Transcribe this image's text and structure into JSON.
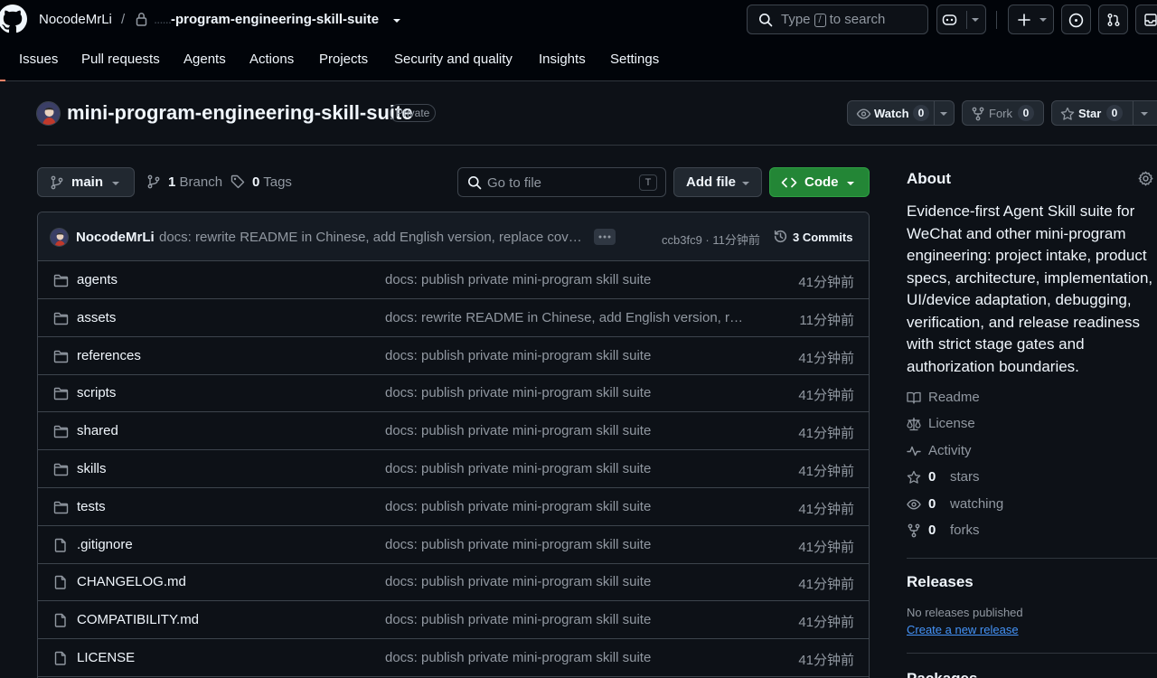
{
  "header": {
    "owner": "NocodeMrLi",
    "separator": "/",
    "repo_redacted": "......",
    "repo_crumb": "-program-engineering-skill-suite",
    "search_prefix": "Type",
    "search_key": "/",
    "search_suffix": "to search"
  },
  "nav": {
    "tabs": [
      {
        "label": "Issues"
      },
      {
        "label": "Pull requests"
      },
      {
        "label": "Agents"
      },
      {
        "label": "Actions"
      },
      {
        "label": "Projects"
      },
      {
        "label": "Security and quality"
      },
      {
        "label": "Insights"
      },
      {
        "label": "Settings"
      }
    ]
  },
  "repo": {
    "name": "mini-program-engineering-skill-suite",
    "visibility": "Private",
    "watch_label": "Watch",
    "watch_count": "0",
    "fork_label": "Fork",
    "fork_count": "0",
    "star_label": "Star",
    "star_count": "0"
  },
  "controls": {
    "branch": "main",
    "branch_count": "1",
    "branch_label": "Branch",
    "tag_count": "0",
    "tag_label": "Tags",
    "goto_placeholder": "Go to file",
    "goto_key": "T",
    "add_file_label": "Add file",
    "code_label": "Code"
  },
  "latest_commit": {
    "author": "NocodeMrLi",
    "message": "docs: rewrite README in Chinese, add English version, replace cover image",
    "sha_time": "ccb3fc9 · 11分钟前",
    "commits_label": "3 Commits"
  },
  "files": [
    {
      "type": "dir",
      "name": "agents",
      "message": "docs: publish private mini-program skill suite",
      "time": "41分钟前"
    },
    {
      "type": "dir",
      "name": "assets",
      "message": "docs: rewrite README in Chinese, add English version, replace cover image",
      "time": "11分钟前"
    },
    {
      "type": "dir",
      "name": "references",
      "message": "docs: publish private mini-program skill suite",
      "time": "41分钟前"
    },
    {
      "type": "dir",
      "name": "scripts",
      "message": "docs: publish private mini-program skill suite",
      "time": "41分钟前"
    },
    {
      "type": "dir",
      "name": "shared",
      "message": "docs: publish private mini-program skill suite",
      "time": "41分钟前"
    },
    {
      "type": "dir",
      "name": "skills",
      "message": "docs: publish private mini-program skill suite",
      "time": "41分钟前"
    },
    {
      "type": "dir",
      "name": "tests",
      "message": "docs: publish private mini-program skill suite",
      "time": "41分钟前"
    },
    {
      "type": "file",
      "name": ".gitignore",
      "message": "docs: publish private mini-program skill suite",
      "time": "41分钟前"
    },
    {
      "type": "file",
      "name": "CHANGELOG.md",
      "message": "docs: publish private mini-program skill suite",
      "time": "41分钟前"
    },
    {
      "type": "file",
      "name": "COMPATIBILITY.md",
      "message": "docs: publish private mini-program skill suite",
      "time": "41分钟前"
    },
    {
      "type": "file",
      "name": "LICENSE",
      "message": "docs: publish private mini-program skill suite",
      "time": "41分钟前"
    }
  ],
  "about": {
    "heading": "About",
    "description": "Evidence-first Agent Skill suite for WeChat and other mini-program engineering: project intake, product specs, architecture, implementation, UI/device adaptation, debugging, verification, and release readiness with strict stage gates and authorization boundaries.",
    "readme": "Readme",
    "license": "License",
    "activity": "Activity",
    "stars_count": "0",
    "stars_label": "stars",
    "watching_count": "0",
    "watching_label": "watching",
    "forks_count": "0",
    "forks_label": "forks"
  },
  "releases": {
    "heading": "Releases",
    "none_text": "No releases published",
    "create_link": "Create a new release"
  },
  "packages": {
    "heading": "Packages"
  },
  "colors": {
    "background": "#0d1117",
    "header_bg": "#010409",
    "border": "#3d444d",
    "text": "#f0f6fc",
    "muted": "#9198a1",
    "link": "#4493f8",
    "code_button": "#238636",
    "tab_underline": "#f78166"
  },
  "icons": [
    "github-logo-icon",
    "lock-icon",
    "search-icon",
    "copilot-icon",
    "plus-icon",
    "issue-icon",
    "pull-request-icon",
    "inbox-icon",
    "eye-icon",
    "fork-icon",
    "star-icon",
    "branch-icon",
    "tag-icon",
    "code-icon",
    "history-icon",
    "folder-icon",
    "file-icon",
    "gear-icon",
    "book-icon",
    "law-icon",
    "pulse-icon"
  ]
}
